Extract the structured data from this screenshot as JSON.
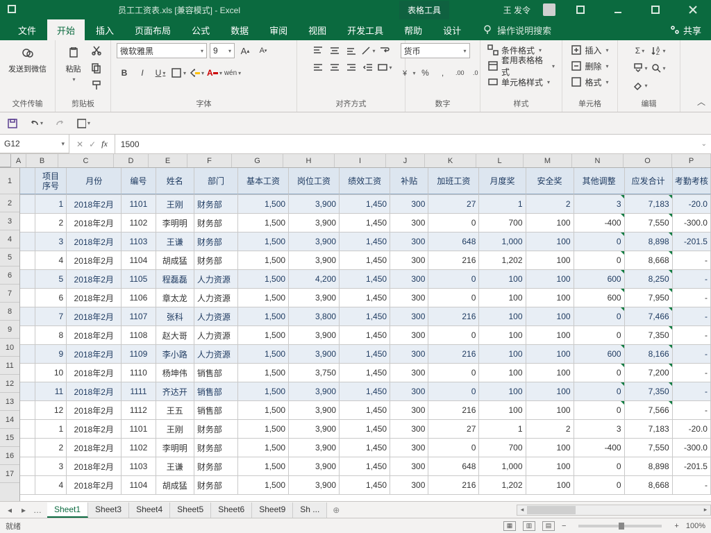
{
  "title_bar": {
    "doc_title": "员工工资表.xls  [兼容模式]  -  Excel",
    "tools_tab": "表格工具",
    "user_name": "王 发令"
  },
  "ribbon_tabs": {
    "file": "文件",
    "home": "开始",
    "insert": "插入",
    "page_layout": "页面布局",
    "formulas": "公式",
    "data": "数据",
    "review": "审阅",
    "view": "视图",
    "dev": "开发工具",
    "help": "帮助",
    "design": "设计",
    "tell_me": "操作说明搜索",
    "share": "共享"
  },
  "ribbon": {
    "group_wechat": {
      "label": "文件传输",
      "btn": "发送到微信"
    },
    "group_clipboard": {
      "label": "剪贴板",
      "paste": "粘贴"
    },
    "group_font": {
      "label": "字体",
      "font_name": "微软雅黑",
      "font_size": "9"
    },
    "group_align": {
      "label": "对齐方式"
    },
    "group_number": {
      "label": "数字",
      "format": "货币"
    },
    "group_styles": {
      "label": "样式",
      "cond": "条件格式",
      "table": "套用表格格式",
      "cell": "单元格样式"
    },
    "group_cells": {
      "label": "单元格",
      "insert": "插入",
      "delete": "删除",
      "format": "格式"
    },
    "group_edit": {
      "label": "编辑"
    }
  },
  "formula_bar": {
    "name_box": "G12",
    "formula": "1500"
  },
  "columns": [
    "A",
    "B",
    "C",
    "D",
    "E",
    "F",
    "G",
    "H",
    "I",
    "J",
    "K",
    "L",
    "M",
    "N",
    "O",
    "P"
  ],
  "header_row": {
    "B_top": "项目",
    "B_bot": "序号",
    "C": "月份",
    "D": "编号",
    "E": "姓名",
    "F": "部门",
    "G": "基本工资",
    "H": "岗位工资",
    "I": "绩效工资",
    "J": "补贴",
    "K": "加班工资",
    "L": "月度奖",
    "M": "安全奖",
    "N": "其他调整",
    "O": "应发合计",
    "P": "考勤考核"
  },
  "rows": [
    {
      "n": 2,
      "alt": true,
      "B": "1",
      "C": "2018年2月",
      "D": "1101",
      "E": "王刚",
      "F": "财务部",
      "G": "1,500",
      "H": "3,900",
      "I": "1,450",
      "J": "300",
      "K": "27",
      "L": "1",
      "M": "2",
      "N": "3",
      "O": "7,183",
      "P": "-20.0",
      "triN": true,
      "triO": true
    },
    {
      "n": 3,
      "alt": false,
      "B": "2",
      "C": "2018年2月",
      "D": "1102",
      "E": "李明明",
      "F": "财务部",
      "G": "1,500",
      "H": "3,900",
      "I": "1,450",
      "J": "300",
      "K": "0",
      "L": "700",
      "M": "100",
      "N": "-400",
      "O": "7,550",
      "P": "-300.0",
      "triN": true,
      "triO": true
    },
    {
      "n": 4,
      "alt": true,
      "B": "3",
      "C": "2018年2月",
      "D": "1103",
      "E": "王谦",
      "F": "财务部",
      "G": "1,500",
      "H": "3,900",
      "I": "1,450",
      "J": "300",
      "K": "648",
      "L": "1,000",
      "M": "100",
      "N": "0",
      "O": "8,898",
      "P": "-201.5",
      "triN": true,
      "triO": true
    },
    {
      "n": 5,
      "alt": false,
      "B": "4",
      "C": "2018年2月",
      "D": "1104",
      "E": "胡成猛",
      "F": "财务部",
      "G": "1,500",
      "H": "3,900",
      "I": "1,450",
      "J": "300",
      "K": "216",
      "L": "1,202",
      "M": "100",
      "N": "0",
      "O": "8,668",
      "P": "-",
      "triN": true,
      "triO": true
    },
    {
      "n": 6,
      "alt": true,
      "B": "5",
      "C": "2018年2月",
      "D": "1105",
      "E": "程磊磊",
      "F": "人力资源",
      "G": "1,500",
      "H": "4,200",
      "I": "1,450",
      "J": "300",
      "K": "0",
      "L": "100",
      "M": "100",
      "N": "600",
      "O": "8,250",
      "P": "-",
      "triN": true,
      "triO": true
    },
    {
      "n": 7,
      "alt": false,
      "B": "6",
      "C": "2018年2月",
      "D": "1106",
      "E": "章太龙",
      "F": "人力资源",
      "G": "1,500",
      "H": "3,900",
      "I": "1,450",
      "J": "300",
      "K": "0",
      "L": "100",
      "M": "100",
      "N": "600",
      "O": "7,950",
      "P": "-",
      "triN": true,
      "triO": true
    },
    {
      "n": 8,
      "alt": true,
      "B": "7",
      "C": "2018年2月",
      "D": "1107",
      "E": "张科",
      "F": "人力资源",
      "G": "1,500",
      "H": "3,800",
      "I": "1,450",
      "J": "300",
      "K": "216",
      "L": "100",
      "M": "100",
      "N": "0",
      "O": "7,466",
      "P": "-",
      "triN": true,
      "triO": true
    },
    {
      "n": 9,
      "alt": false,
      "B": "8",
      "C": "2018年2月",
      "D": "1108",
      "E": "赵大哥",
      "F": "人力资源",
      "G": "1,500",
      "H": "3,900",
      "I": "1,450",
      "J": "300",
      "K": "0",
      "L": "100",
      "M": "100",
      "N": "0",
      "O": "7,350",
      "P": "-",
      "triO": true
    },
    {
      "n": 10,
      "alt": true,
      "B": "9",
      "C": "2018年2月",
      "D": "1109",
      "E": "李小路",
      "F": "人力资源",
      "G": "1,500",
      "H": "3,900",
      "I": "1,450",
      "J": "300",
      "K": "216",
      "L": "100",
      "M": "100",
      "N": "600",
      "O": "8,166",
      "P": "-",
      "triN": true,
      "triO": true
    },
    {
      "n": 11,
      "alt": false,
      "B": "10",
      "C": "2018年2月",
      "D": "1110",
      "E": "杨坤伟",
      "F": "销售部",
      "G": "1,500",
      "H": "3,750",
      "I": "1,450",
      "J": "300",
      "K": "0",
      "L": "100",
      "M": "100",
      "N": "0",
      "O": "7,200",
      "P": "-",
      "triN": true,
      "triO": true
    },
    {
      "n": 12,
      "alt": true,
      "B": "11",
      "C": "2018年2月",
      "D": "1111",
      "E": "齐达开",
      "F": "销售部",
      "G": "1,500",
      "H": "3,900",
      "I": "1,450",
      "J": "300",
      "K": "0",
      "L": "100",
      "M": "100",
      "N": "0",
      "O": "7,350",
      "P": "-",
      "triN": true,
      "triO": true
    },
    {
      "n": 13,
      "alt": false,
      "B": "12",
      "C": "2018年2月",
      "D": "1112",
      "E": "王五",
      "F": "销售部",
      "G": "1,500",
      "H": "3,900",
      "I": "1,450",
      "J": "300",
      "K": "216",
      "L": "100",
      "M": "100",
      "N": "0",
      "O": "7,566",
      "P": "-",
      "triN": true,
      "triO": true
    },
    {
      "n": 14,
      "alt": false,
      "B": "1",
      "C": "2018年2月",
      "D": "1101",
      "E": "王刚",
      "F": "财务部",
      "G": "1,500",
      "H": "3,900",
      "I": "1,450",
      "J": "300",
      "K": "27",
      "L": "1",
      "M": "2",
      "N": "3",
      "O": "7,183",
      "P": "-20.0"
    },
    {
      "n": 15,
      "alt": false,
      "B": "2",
      "C": "2018年2月",
      "D": "1102",
      "E": "李明明",
      "F": "财务部",
      "G": "1,500",
      "H": "3,900",
      "I": "1,450",
      "J": "300",
      "K": "0",
      "L": "700",
      "M": "100",
      "N": "-400",
      "O": "7,550",
      "P": "-300.0"
    },
    {
      "n": 16,
      "alt": false,
      "B": "3",
      "C": "2018年2月",
      "D": "1103",
      "E": "王谦",
      "F": "财务部",
      "G": "1,500",
      "H": "3,900",
      "I": "1,450",
      "J": "300",
      "K": "648",
      "L": "1,000",
      "M": "100",
      "N": "0",
      "O": "8,898",
      "P": "-201.5"
    },
    {
      "n": 17,
      "alt": false,
      "B": "4",
      "C": "2018年2月",
      "D": "1104",
      "E": "胡成猛",
      "F": "财务部",
      "G": "1,500",
      "H": "3,900",
      "I": "1,450",
      "J": "300",
      "K": "216",
      "L": "1,202",
      "M": "100",
      "N": "0",
      "O": "8,668",
      "P": "-"
    }
  ],
  "sheet_tabs": [
    "Sheet1",
    "Sheet3",
    "Sheet4",
    "Sheet5",
    "Sheet6",
    "Sheet9",
    "Sh  ..."
  ],
  "status": {
    "ready": "就绪",
    "zoom": "100%"
  }
}
